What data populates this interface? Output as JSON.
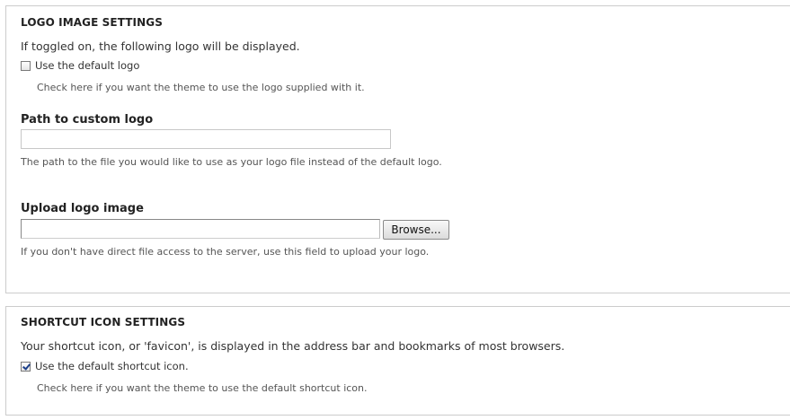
{
  "logo_settings": {
    "legend": "LOGO IMAGE SETTINGS",
    "description": "If toggled on, the following logo will be displayed.",
    "default_logo": {
      "label": "Use the default logo",
      "checked": false,
      "help": "Check here if you want the theme to use the logo supplied with it."
    },
    "path": {
      "label": "Path to custom logo",
      "value": "",
      "help": "The path to the file you would like to use as your logo file instead of the default logo."
    },
    "upload": {
      "label": "Upload logo image",
      "value": "",
      "button_label": "Browse...",
      "help": "If you don't have direct file access to the server, use this field to upload your logo."
    }
  },
  "shortcut_settings": {
    "legend": "SHORTCUT ICON SETTINGS",
    "description": "Your shortcut icon, or 'favicon', is displayed in the address bar and bookmarks of most browsers.",
    "default_shortcut": {
      "label": "Use the default shortcut icon.",
      "checked": true,
      "help": "Check here if you want the theme to use the default shortcut icon."
    }
  }
}
